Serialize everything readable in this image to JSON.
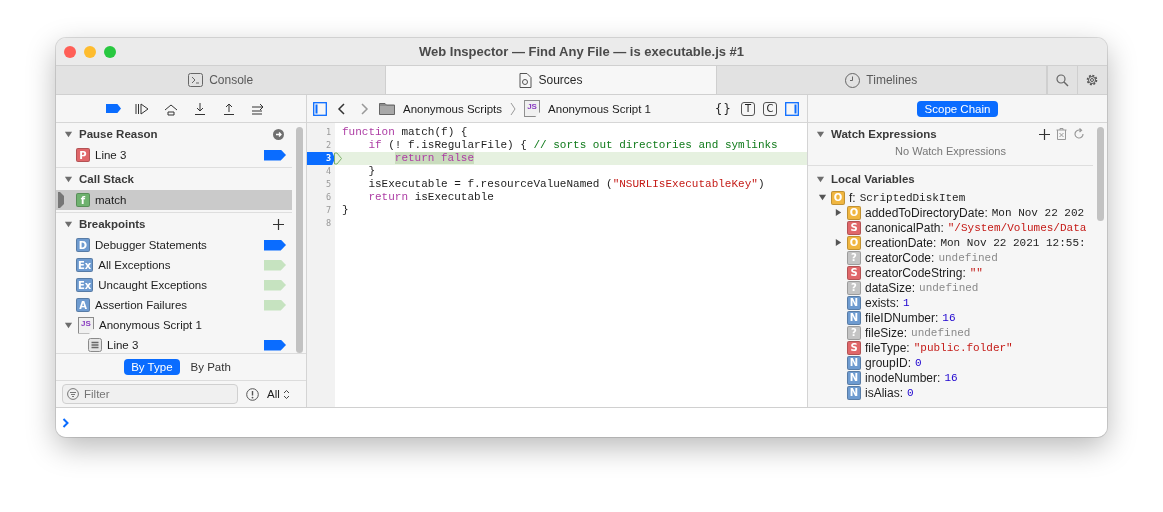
{
  "window": {
    "title": "Web Inspector — Find Any File — is executable.js #1"
  },
  "tabs": [
    {
      "label": "Console",
      "selected": false
    },
    {
      "label": "Sources",
      "selected": true
    },
    {
      "label": "Timelines",
      "selected": false
    }
  ],
  "debugger_toolbar": {
    "breakpoints_active": true
  },
  "pause_reason": {
    "title": "Pause Reason",
    "expanded": true,
    "items": [
      {
        "kind": "letter",
        "badge": "P",
        "color": "#e0676a",
        "label": "Line 3",
        "enabled": true
      }
    ]
  },
  "call_stack": {
    "title": "Call Stack",
    "expanded": true,
    "frames": [
      {
        "kind": "letter",
        "badge": "f",
        "color": "#6fb26f",
        "label": "match",
        "selected": true
      }
    ]
  },
  "breakpoints": {
    "title": "Breakpoints",
    "expanded": true,
    "items": [
      {
        "kind": "letter",
        "badge": "D",
        "color": "#6e9bd0",
        "label": "Debugger Statements",
        "enabled": true
      },
      {
        "kind": "letter",
        "badge": "Ex",
        "color": "#6e9bd0",
        "label": "All Exceptions",
        "enabled": false
      },
      {
        "kind": "letter",
        "badge": "Ex",
        "color": "#6e9bd0",
        "label": "Uncaught Exceptions",
        "enabled": false
      },
      {
        "kind": "letter",
        "badge": "A",
        "color": "#6e9bd0",
        "label": "Assertion Failures",
        "enabled": false
      },
      {
        "kind": "script",
        "badge": "JS",
        "label": "Anonymous Script 1",
        "expanded": true,
        "children": [
          {
            "kind": "line",
            "label": "Line 3",
            "enabled": true
          }
        ]
      }
    ]
  },
  "scope_toggle": [
    {
      "label": "By Type",
      "selected": true
    },
    {
      "label": "By Path",
      "selected": false
    }
  ],
  "filter": {
    "placeholder": "Filter",
    "scope": "All"
  },
  "editor": {
    "path": [
      {
        "kind": "folder",
        "label": "Anonymous Scripts"
      },
      {
        "kind": "script",
        "badge": "JS",
        "label": "Anonymous Script 1"
      }
    ],
    "buttons": [
      "{}",
      "T",
      "C"
    ],
    "lines": [
      {
        "number": "1",
        "current": false,
        "breakpoint": false,
        "tokens": [
          {
            "kind": "keyword",
            "text": "function"
          },
          {
            "kind": "plain",
            "text": " match(f) {"
          }
        ]
      },
      {
        "number": "2",
        "current": false,
        "breakpoint": false,
        "tokens": [
          {
            "kind": "keyword",
            "text": "    if"
          },
          {
            "kind": "plain",
            "text": " (! f.isRegularFile) { "
          },
          {
            "kind": "comment",
            "text": "// sorts out directories and symlinks"
          }
        ]
      },
      {
        "number": "3",
        "current": true,
        "breakpoint": true,
        "tokens": [
          {
            "kind": "keyword",
            "text": "        return false",
            "highlighted": true
          }
        ]
      },
      {
        "number": "4",
        "current": false,
        "breakpoint": false,
        "tokens": [
          {
            "kind": "plain",
            "text": "    }"
          }
        ]
      },
      {
        "number": "5",
        "current": false,
        "breakpoint": false,
        "tokens": [
          {
            "kind": "plain",
            "text": "    isExecutable = f.resourceValueNamed ("
          },
          {
            "kind": "string",
            "text": "\"NSURLIsExecutableKey\""
          },
          {
            "kind": "plain",
            "text": ")"
          }
        ]
      },
      {
        "number": "6",
        "current": false,
        "breakpoint": false,
        "tokens": [
          {
            "kind": "keyword",
            "text": "    return"
          },
          {
            "kind": "plain",
            "text": " isExecutable"
          }
        ]
      },
      {
        "number": "7",
        "current": false,
        "breakpoint": false,
        "tokens": [
          {
            "kind": "plain",
            "text": "}"
          }
        ]
      },
      {
        "number": "8",
        "current": false,
        "breakpoint": false
      }
    ]
  },
  "details": {
    "button": {
      "label": "Scope Chain",
      "selected": true
    },
    "watch": {
      "title": "Watch Expressions",
      "expanded": true,
      "empty_text": "No Watch Expressions"
    },
    "locals": {
      "title": "Local Variables",
      "expanded": true,
      "variables": [
        {
          "badge": "O",
          "color": "#f0b640",
          "name": "f:",
          "value": "ScriptedDiskItem",
          "kind": "object",
          "expanded": true,
          "children": [
            {
              "badge": "O",
              "color": "#f0b640",
              "name": "addedToDirectoryDate:",
              "value": "Mon Nov 22 202",
              "kind": "object",
              "expanded": false
            },
            {
              "badge": "S",
              "color": "#e0676a",
              "name": "canonicalPath:",
              "value": "\"/System/Volumes/Data",
              "kind": "string"
            },
            {
              "badge": "O",
              "color": "#f0b640",
              "name": "creationDate:",
              "value": "Mon Nov 22 2021 12:55:",
              "kind": "object",
              "expanded": false
            },
            {
              "badge": "?",
              "color": "#c4c4c4",
              "name": "creatorCode:",
              "value": "undefined",
              "kind": "undefined"
            },
            {
              "badge": "S",
              "color": "#e0676a",
              "name": "creatorCodeString:",
              "value": "\"\"",
              "kind": "string"
            },
            {
              "badge": "?",
              "color": "#c4c4c4",
              "name": "dataSize:",
              "value": "undefined",
              "kind": "undefined"
            },
            {
              "badge": "N",
              "color": "#6e9bd0",
              "name": "exists:",
              "value": "1",
              "kind": "number"
            },
            {
              "badge": "N",
              "color": "#6e9bd0",
              "name": "fileIDNumber:",
              "value": "16",
              "kind": "number"
            },
            {
              "badge": "?",
              "color": "#c4c4c4",
              "name": "fileSize:",
              "value": "undefined",
              "kind": "undefined"
            },
            {
              "badge": "S",
              "color": "#e0676a",
              "name": "fileType:",
              "value": "\"public.folder\"",
              "kind": "string"
            },
            {
              "badge": "N",
              "color": "#6e9bd0",
              "name": "groupID:",
              "value": "0",
              "kind": "number"
            },
            {
              "badge": "N",
              "color": "#6e9bd0",
              "name": "inodeNumber:",
              "value": "16",
              "kind": "number"
            },
            {
              "badge": "N",
              "color": "#6e9bd0",
              "name": "isAlias:",
              "value": "0",
              "kind": "number"
            }
          ]
        }
      ]
    }
  }
}
